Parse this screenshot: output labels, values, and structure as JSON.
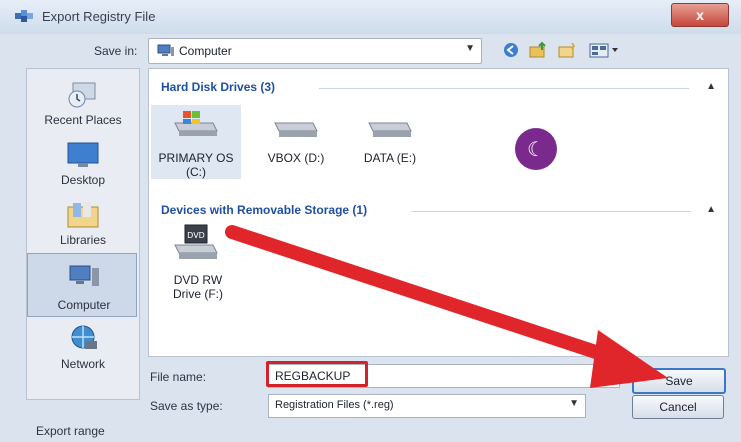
{
  "window": {
    "title": "Export Registry File",
    "close_label": "x"
  },
  "toolbar": {
    "save_in_label": "Save in:",
    "location": "Computer",
    "icons": [
      "back-icon",
      "up-folder-icon",
      "new-folder-icon",
      "view-menu-icon"
    ]
  },
  "places": [
    {
      "label": "Recent Places",
      "icon": "recent-places-icon"
    },
    {
      "label": "Desktop",
      "icon": "desktop-icon"
    },
    {
      "label": "Libraries",
      "icon": "libraries-icon"
    },
    {
      "label": "Computer",
      "icon": "computer-icon",
      "selected": true
    },
    {
      "label": "Network",
      "icon": "network-icon"
    }
  ],
  "groups": {
    "hard_disks": {
      "title": "Hard Disk Drives (3)",
      "drives": [
        {
          "label_line1": "PRIMARY OS",
          "label_line2": "(C:)",
          "selected": true
        },
        {
          "label_line1": "VBOX (D:)",
          "label_line2": ""
        },
        {
          "label_line1": "DATA (E:)",
          "label_line2": ""
        }
      ]
    },
    "removable": {
      "title": "Devices with Removable Storage (1)",
      "drives": [
        {
          "label_line1": "DVD RW",
          "label_line2": "Drive (F:)",
          "badge": "DVD"
        }
      ]
    }
  },
  "form": {
    "file_name_label": "File name:",
    "file_name_value": "REGBACKUP",
    "save_type_label": "Save as type:",
    "save_type_value": "Registration Files (*.reg)",
    "save_button": "Save",
    "cancel_button": "Cancel",
    "export_range_label": "Export range"
  },
  "overlay": {
    "badge_glyph": "☾",
    "arrow_color": "#e0262b",
    "badge_color": "#7a2a8c"
  }
}
